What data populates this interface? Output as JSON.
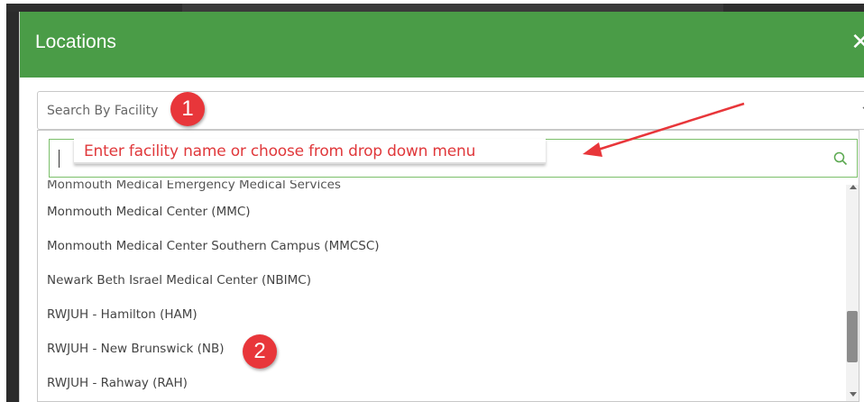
{
  "dialog": {
    "title": "Locations",
    "close_symbol": "✕"
  },
  "facility_select": {
    "placeholder": "Search By Facility"
  },
  "annotation": {
    "callout_text": "Enter facility name or choose from drop down menu",
    "step1": "1",
    "step2": "2"
  },
  "facilities": [
    "Monmouth Medical Center (MMC)",
    "Monmouth Medical Center Southern Campus (MMCSC)",
    "Newark Beth Israel Medical Center (NBIMC)",
    "RWJUH - Hamilton (HAM)",
    "RWJUH - New Brunswick (NB)",
    "RWJUH - Rahway (RAH)"
  ],
  "colors": {
    "header": "#4a9c47",
    "annotation": "#e8363a"
  },
  "icons": {
    "search": "search-icon",
    "chevron": "chevron-down-icon",
    "close": "close-icon"
  }
}
